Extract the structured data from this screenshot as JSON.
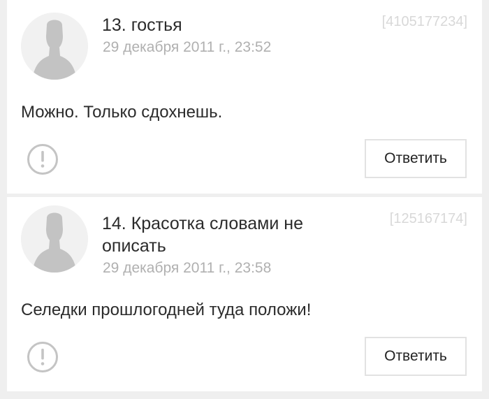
{
  "comments": [
    {
      "author": "13. гостья",
      "date": "29 декабря 2011 г., 23:52",
      "id": "[4105177234]",
      "text": "Можно. Только сдохнешь.",
      "report_icon": "exclamation-circle-icon",
      "reply_label": "Ответить"
    },
    {
      "author": "14. Красотка словами не описать",
      "date": "29 декабря 2011 г., 23:58",
      "id": "[125167174]",
      "text": "Селедки прошлогодней туда положи!",
      "report_icon": "exclamation-circle-icon",
      "reply_label": "Ответить"
    }
  ],
  "colors": {
    "background": "#efefef",
    "card": "#ffffff",
    "text": "#2b2b2b",
    "muted": "#b0b0b0",
    "id": "#d8d8d8",
    "avatar_silhouette": "#c3c3c3"
  }
}
